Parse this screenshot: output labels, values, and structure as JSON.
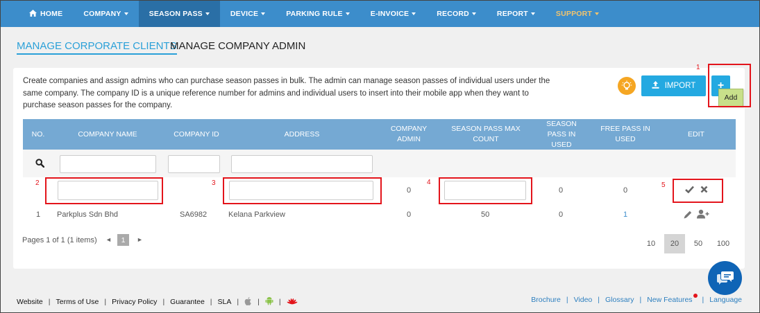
{
  "nav": {
    "home": "HOME",
    "items": [
      "COMPANY",
      "SEASON PASS",
      "DEVICE",
      "PARKING RULE",
      "E-INVOICE",
      "RECORD",
      "REPORT",
      "SUPPORT"
    ]
  },
  "tabs": {
    "corporate": "MANAGE CORPORATE CLIENTS",
    "admin": "MANAGE COMPANY ADMIN"
  },
  "card": {
    "description": "Create companies and assign admins who can purchase season passes in bulk. The admin can manage season passes of individual users under the same company. The company ID is a unique reference number for admins and individual users to insert into their mobile app when they want to purchase season passes for the company.",
    "import_label": "IMPORT",
    "add_symbol": "+",
    "tooltip": "Add"
  },
  "table": {
    "headers": [
      "NO.",
      "COMPANY NAME",
      "COMPANY ID",
      "ADDRESS",
      "COMPANY ADMIN",
      "SEASON PASS MAX COUNT",
      "SEASON PASS IN USED",
      "FREE PASS IN USED",
      "EDIT"
    ],
    "new_row": {
      "company_admin": "0",
      "season_pass_in_used": "0",
      "free_pass_in_used": "0"
    },
    "rows": [
      {
        "no": "1",
        "company_name": "Parkplus Sdn Bhd",
        "company_id": "SA6982",
        "address": "Kelana Parkview",
        "company_admin": "0",
        "max_count": "50",
        "in_used": "0",
        "free_pass": "1"
      }
    ]
  },
  "pager": {
    "text": "Pages 1 of 1 (1 items)",
    "current": "1",
    "sizes": [
      "10",
      "20",
      "50",
      "100"
    ]
  },
  "annotations": [
    "1",
    "2",
    "3",
    "4",
    "5"
  ],
  "footer": {
    "left": [
      "Website",
      "Terms of Use",
      "Privacy Policy",
      "Guarantee",
      "SLA"
    ],
    "right": [
      "Brochure",
      "Video",
      "Glossary",
      "New Features",
      "Language"
    ]
  },
  "colors": {
    "nav": "#3c8dcb",
    "nav_active": "#2a6fa6",
    "support": "#f2c46d",
    "accent": "#24a9e1",
    "table_header": "#75a9d3",
    "annotation": "#e3141b"
  }
}
